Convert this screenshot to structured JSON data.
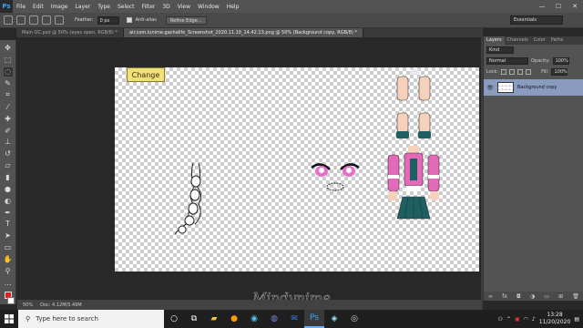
{
  "app": {
    "logo": "Ps"
  },
  "menu": [
    "File",
    "Edit",
    "Image",
    "Layer",
    "Type",
    "Select",
    "Filter",
    "3D",
    "View",
    "Window",
    "Help"
  ],
  "window_controls": {
    "minimize": "—",
    "maximize": "☐",
    "close": "✕"
  },
  "options_bar": {
    "feather_label": "Feather:",
    "feather_value": "0 px",
    "antialias_label": "Anti-alias",
    "refine_label": "Refine Edge...",
    "workspace": "Essentials"
  },
  "tabs": [
    {
      "label": "Main OC.psd @ 50% (eyes open, RGB/8) *"
    },
    {
      "label": "air.com.lunime.gachalife_Screenshot_2020.11.10_14.42.13.png @ 50% (Background copy, RGB/8) *"
    }
  ],
  "canvas": {
    "badge_text": "Change"
  },
  "status": {
    "zoom": "50%",
    "doc": "Doc: 4.12M/5.49M"
  },
  "watermark": "Mindynime",
  "layers_panel": {
    "tabs": [
      "Layers",
      "Channels",
      "Color",
      "Paths"
    ],
    "kind_label": "Kind",
    "blend_mode": "Normal",
    "opacity_label": "Opacity:",
    "opacity_value": "100%",
    "lock_label": "Lock:",
    "fill_label": "Fill:",
    "fill_value": "100%",
    "layer_name": "Background copy"
  },
  "taskbar": {
    "search_placeholder": "Type here to search",
    "time": "13:28",
    "date": "11/20/2020"
  },
  "colors": {
    "foreground": "#e02020",
    "background": "#ffffff",
    "accent": "#31a8ff"
  }
}
